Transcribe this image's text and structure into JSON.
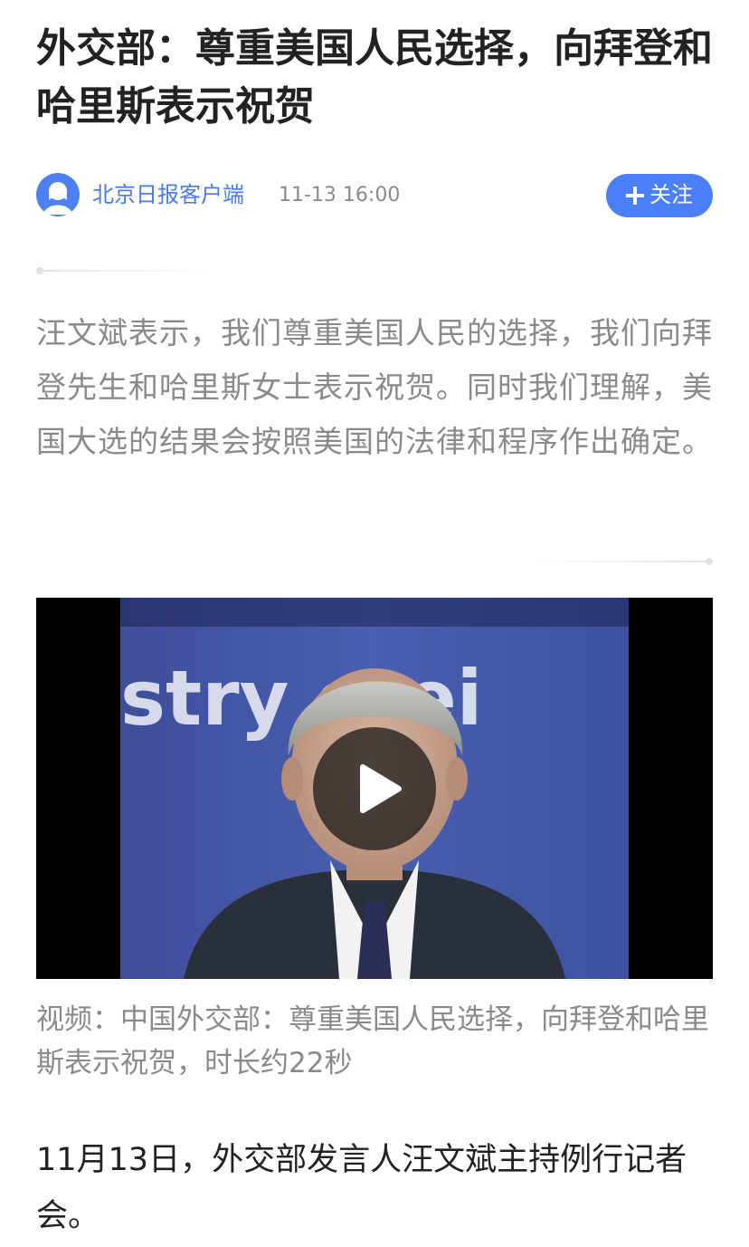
{
  "article": {
    "title": "外交部：尊重美国人民选择，向拜登和哈里斯表示祝贺",
    "source": "北京日报客户端",
    "publish_time": "11-13 16:00",
    "follow_label": "关注",
    "summary": "汪文斌表示，我们尊重美国人民的选择，我们向拜登先生和哈里斯女士表示祝贺。同时我们理解，美国大选的结果会按照美国的法律和程序作出确定。",
    "video": {
      "frame_text": "stry   orei",
      "caption": "视频：中国外交部：尊重美国人民选择，向拜登和哈里斯表示祝贺，时长约22秒"
    },
    "body": "11月13日，外交部发言人汪文斌主持例行记者会。"
  },
  "icons": {
    "avatar": "user-avatar-icon",
    "follow": "plus-icon",
    "play": "play-icon"
  },
  "colors": {
    "accent": "#4b7ff5",
    "source_text": "#4a79f0",
    "muted_text": "#8a8a8a",
    "body_text": "#222222",
    "video_bg": "#000000"
  }
}
